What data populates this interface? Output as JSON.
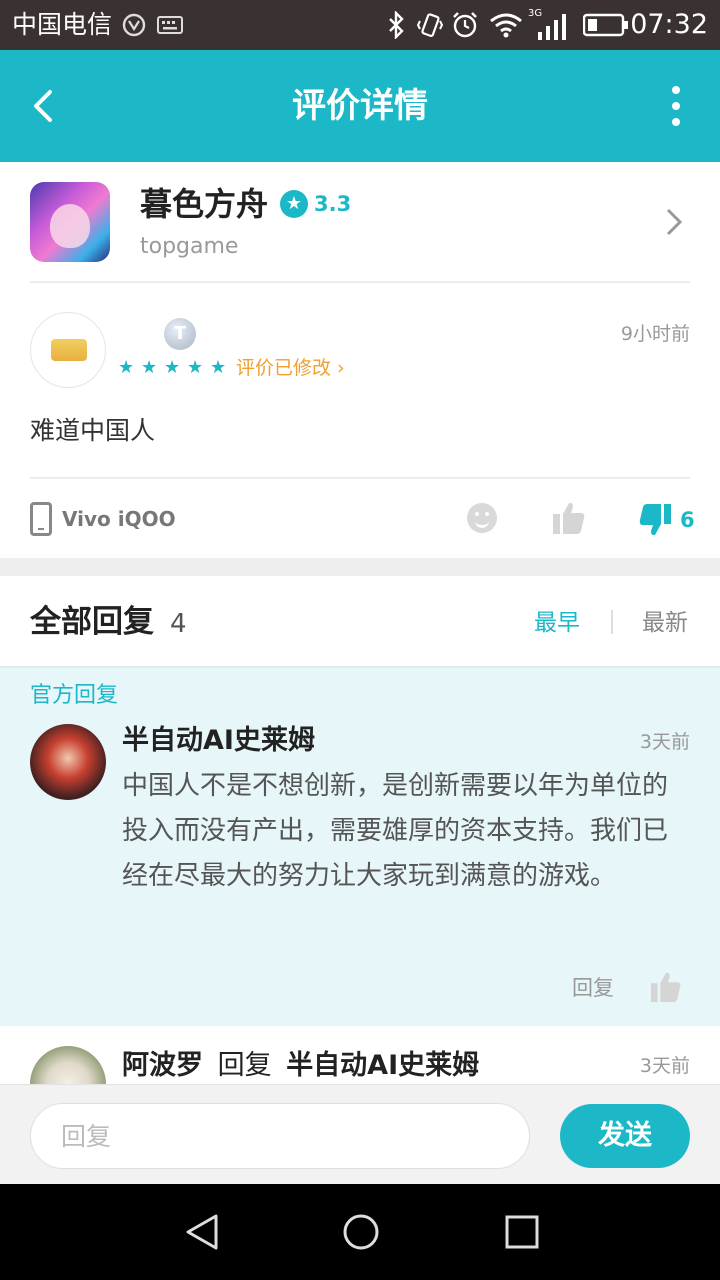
{
  "status_bar": {
    "carrier": "中国电信",
    "time": "07:32",
    "network": "3G",
    "icons": [
      "nfc-icon",
      "keyboard-icon",
      "bluetooth-icon",
      "vibrate-icon",
      "alarm-icon",
      "wifi-icon",
      "signal-icon",
      "battery-icon"
    ]
  },
  "header": {
    "title": "评价详情",
    "back_icon": "back-arrow-icon",
    "menu_icon": "more-vertical-icon",
    "accent_color": "#1cb8c8"
  },
  "game": {
    "name": "暮色方舟",
    "rating": "3.3",
    "publisher": "topgame"
  },
  "review": {
    "badge": "T",
    "stars": 5,
    "edited_label": "评价已修改 ›",
    "time": "9小时前",
    "text": "难道中国人",
    "device": "Vivo iQOO",
    "dislike_count": "6"
  },
  "replies": {
    "title": "全部回复",
    "count": "4",
    "sort_earliest": "最早",
    "sort_latest": "最新",
    "official_label": "官方回复",
    "items": [
      {
        "author": "半自动AI史莱姆",
        "time": "3天前",
        "text": "中国人不是不想创新，是创新需要以年为单位的投入而没有产出，需要雄厚的资本支持。我们已经在尽最大的努力让大家玩到满意的游戏。",
        "reply_label": "回复"
      },
      {
        "author": "阿波罗",
        "reply_word": "回复",
        "reply_to": "半自动AI史莱姆",
        "time": "3天前"
      }
    ]
  },
  "input_bar": {
    "placeholder": "回复",
    "send_label": "发送"
  }
}
